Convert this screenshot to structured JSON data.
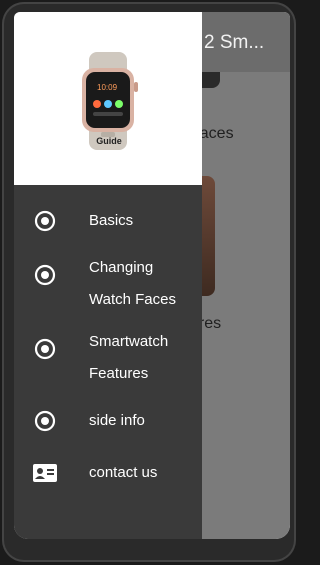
{
  "app": {
    "title": "2 Sm..."
  },
  "content": {
    "cards": [
      {
        "label": "Faces"
      },
      {
        "label": "ures"
      }
    ]
  },
  "drawer": {
    "header_image_caption": "Guide",
    "items": [
      {
        "label": "Basics",
        "icon": "radio-button-icon"
      },
      {
        "label": "Changing\nWatch Faces",
        "icon": "radio-button-icon"
      },
      {
        "label": "Smartwatch\nFeatures",
        "icon": "radio-button-icon"
      },
      {
        "label": "side info",
        "icon": "radio-button-icon"
      },
      {
        "label": "contact us",
        "icon": "contact-card-icon"
      }
    ]
  },
  "colors": {
    "drawer_bg": "#3a3a3a",
    "drawer_header_bg": "#ffffff",
    "toolbar_dimmed": "#6c6c6c",
    "text": "#ffffff"
  }
}
